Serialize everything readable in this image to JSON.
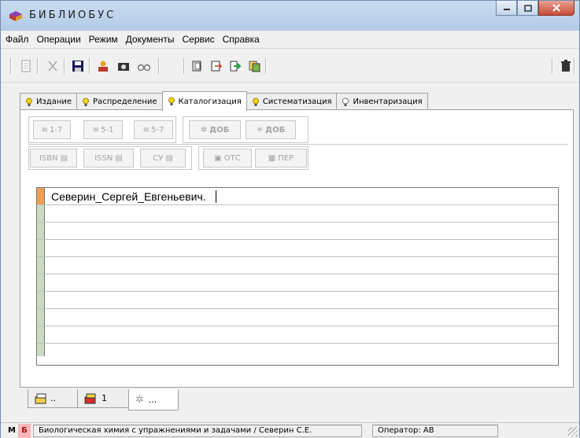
{
  "window": {
    "title": "БИБЛИОБУС"
  },
  "menu": [
    {
      "label": "Файл"
    },
    {
      "label": "Операции"
    },
    {
      "label": "Режим"
    },
    {
      "label": "Документы"
    },
    {
      "label": "Сервис"
    },
    {
      "label": "Справка"
    }
  ],
  "tabs": [
    {
      "label": "Издание"
    },
    {
      "label": "Распределение"
    },
    {
      "label": "Каталогизация"
    },
    {
      "label": "Систематизация"
    },
    {
      "label": "Инвентаризация"
    }
  ],
  "format_buttons": {
    "b1": "1-7",
    "b2": "5-1",
    "b3": "5-7",
    "dob1": "ДОБ",
    "dob2": "ДОБ",
    "isbn": "ISBN",
    "issn": "ISSN",
    "su": "СУ",
    "ots": "ОТС",
    "per": "ПЕР"
  },
  "editor": {
    "first_line": "Северин_Сергей_Евгеньевич."
  },
  "bottom_tabs": [
    {
      "label": ".."
    },
    {
      "label": "1"
    },
    {
      "label": "..."
    }
  ],
  "status": {
    "m": "М",
    "b": "Б",
    "record": "Биологическая химия с упражнениями и задачами / Северин С.Е.",
    "operator": "Оператор: АВ"
  }
}
